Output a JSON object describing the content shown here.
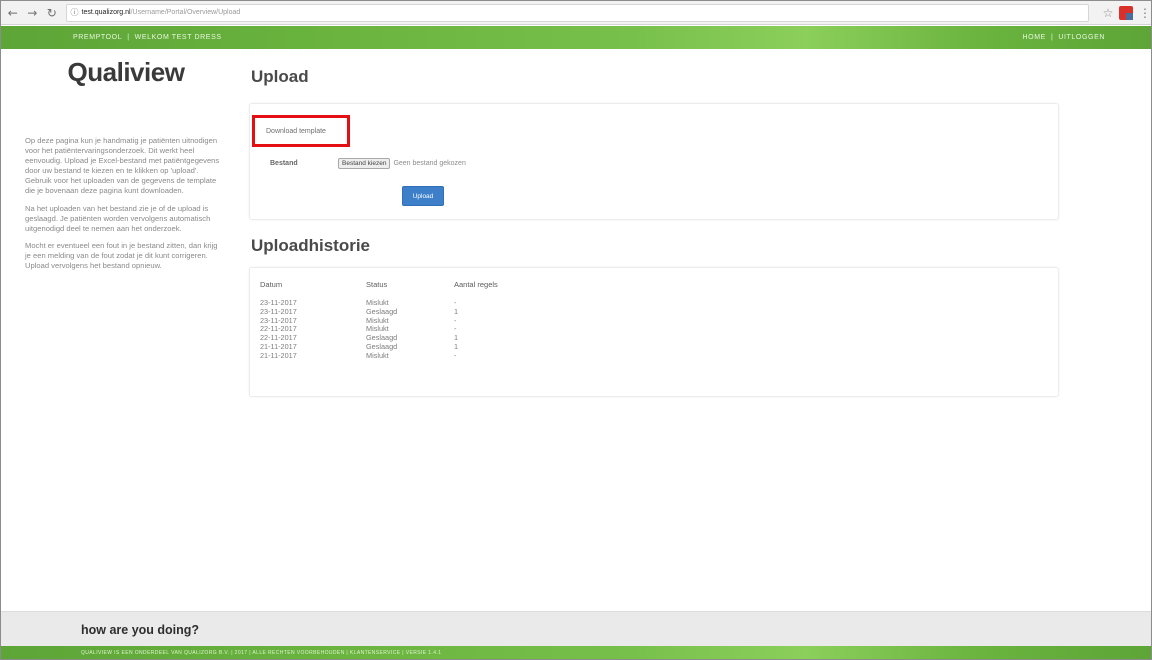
{
  "browser": {
    "url_host": "test.qualizorg.nl",
    "url_path": "/Username/Portal/Overview/Upload",
    "back_icon": "arrow-left-icon",
    "forward_icon": "arrow-right-icon",
    "reload_icon": "reload-icon"
  },
  "topbar": {
    "left_items": [
      "Premptool",
      "Welkom Test Dress"
    ],
    "right_items": [
      "Home",
      "Uitloggen"
    ]
  },
  "sidebar": {
    "logo": "Qualiview",
    "paragraphs": [
      "Op deze pagina kun je handmatig je patiënten uitnodigen voor het patiëntervaringsonderzoek. Dit werkt heel eenvoudig. Upload je Excel-bestand met patiëntgegevens door uw bestand te kiezen en te klikken op 'upload'. Gebruik voor het uploaden van de gegevens de template die je bovenaan deze pagina kunt downloaden.",
      "Na het uploaden van het bestand zie je of de upload is geslaagd. Je patiënten worden vervolgens automatisch uitgenodigd deel te nemen aan het onderzoek.",
      "Mocht er eventueel een fout in je bestand zitten, dan krijg je een melding van de fout zodat je dit kunt corrigeren. Upload vervolgens het bestand opnieuw."
    ]
  },
  "upload": {
    "heading": "Upload",
    "template_button": "Download template",
    "file_label": "Bestand",
    "file_button": "Bestand kiezen",
    "file_status": "Geen bestand gekozen",
    "submit_button": "Upload"
  },
  "history": {
    "heading": "Uploadhistorie",
    "columns": [
      "Datum",
      "Status",
      "Aantal regels"
    ],
    "rows": [
      [
        "23-11-2017",
        "Mislukt",
        "-"
      ],
      [
        "23-11-2017",
        "Geslaagd",
        "1"
      ],
      [
        "23-11-2017",
        "Mislukt",
        "-"
      ],
      [
        "22-11-2017",
        "Mislukt",
        "-"
      ],
      [
        "22-11-2017",
        "Geslaagd",
        "1"
      ],
      [
        "21-11-2017",
        "Geslaagd",
        "1"
      ],
      [
        "21-11-2017",
        "Mislukt",
        "-"
      ]
    ]
  },
  "footer": {
    "question": "how are you doing?",
    "legal": "Qualiview is een onderdeel van Qualizorg B.V. | 2017 | Alle rechten voorbehouden | Klantenservice | Versie 1.4.1"
  },
  "colors": {
    "green": "#6ab43f",
    "highlight_red": "#e30f13",
    "button_blue": "#3d7fc9"
  }
}
